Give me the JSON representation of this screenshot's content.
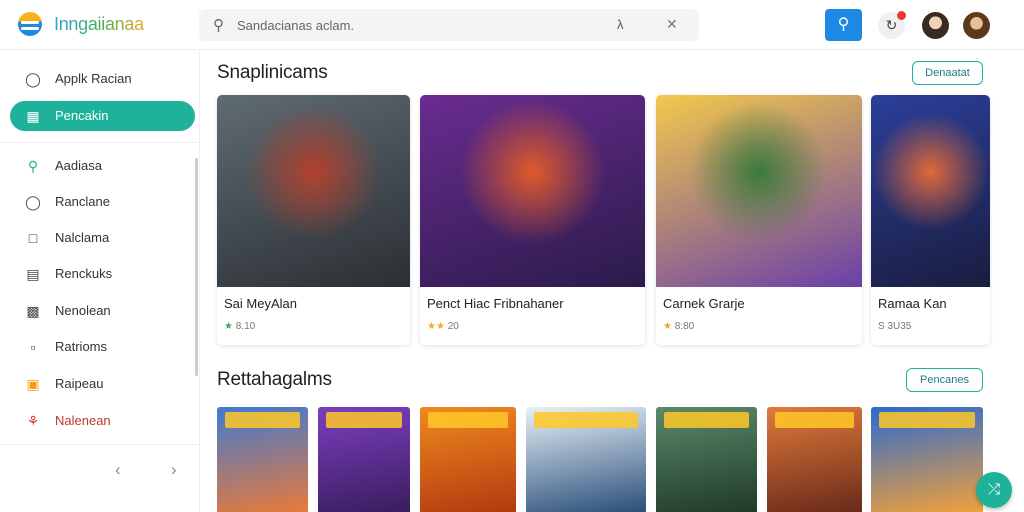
{
  "header": {
    "brand": "Inngaiianaa",
    "search_placeholder": "Sandacianas aclam.",
    "icons": {
      "logo": "app-logo-icon",
      "search": "search-icon",
      "mic": "microphone-icon",
      "clear": "close-icon",
      "notifications": "bell-icon"
    }
  },
  "sidebar": {
    "items": [
      {
        "label": "Applk Racian",
        "icon": "user-icon",
        "active": false
      },
      {
        "label": "Pencakin",
        "icon": "grid-icon",
        "active": true
      },
      {
        "label": "Aadiasa",
        "icon": "key-icon",
        "active": false
      },
      {
        "label": "Ranclane",
        "icon": "globe-icon",
        "active": false
      },
      {
        "label": "Nalclama",
        "icon": "square-icon",
        "active": false
      },
      {
        "label": "Renckuks",
        "icon": "window-icon",
        "active": false
      },
      {
        "label": "Nenolean",
        "icon": "dots-grid-icon",
        "active": false
      },
      {
        "label": "Ratrioms",
        "icon": "message-icon",
        "active": false
      },
      {
        "label": "Raipeau",
        "icon": "puzzle-icon",
        "active": false
      },
      {
        "label": "Nalenean",
        "icon": "headset-icon",
        "active": false
      }
    ],
    "pager_prev": "‹",
    "pager_next": "›"
  },
  "sections": [
    {
      "title": "Snaplinicams",
      "button": "Denaatat"
    },
    {
      "title": "Rettahagalms",
      "button": "Pencanes"
    }
  ],
  "cards": [
    {
      "title": "Sai MeyAlan",
      "rating": "8.10",
      "stars": "★",
      "colors": [
        "#5f6b73",
        "#2b2f33",
        "#b3412e"
      ]
    },
    {
      "title": "Penct Hiac Fribnahaner",
      "rating": "20",
      "stars": "★★",
      "colors": [
        "#6a2c91",
        "#2a1b4a",
        "#e05a2a"
      ]
    },
    {
      "title": "Carnek Grarje",
      "rating": "8:80",
      "stars": "★",
      "colors": [
        "#f2c94c",
        "#6a3fa8",
        "#3b7a3b"
      ]
    },
    {
      "title": "Ramaa Kan",
      "rating": "S 3U35",
      "stars": "",
      "colors": [
        "#2b3f9a",
        "#1a1d3f",
        "#e0683a"
      ]
    }
  ],
  "tiles": [
    {
      "colors": [
        "#3f7ad1",
        "#e87a3a"
      ]
    },
    {
      "colors": [
        "#7b3fbf",
        "#3a1d5f"
      ]
    },
    {
      "colors": [
        "#f08a1e",
        "#b33a10"
      ]
    },
    {
      "colors": [
        "#e9f1f7",
        "#2a4f7a"
      ]
    },
    {
      "colors": [
        "#5a8a6a",
        "#203a2a"
      ]
    },
    {
      "colors": [
        "#e07a3a",
        "#6a2a1a"
      ]
    },
    {
      "colors": [
        "#2a6ad1",
        "#f0a03a"
      ]
    }
  ],
  "fab_icon": "shuffle-icon"
}
